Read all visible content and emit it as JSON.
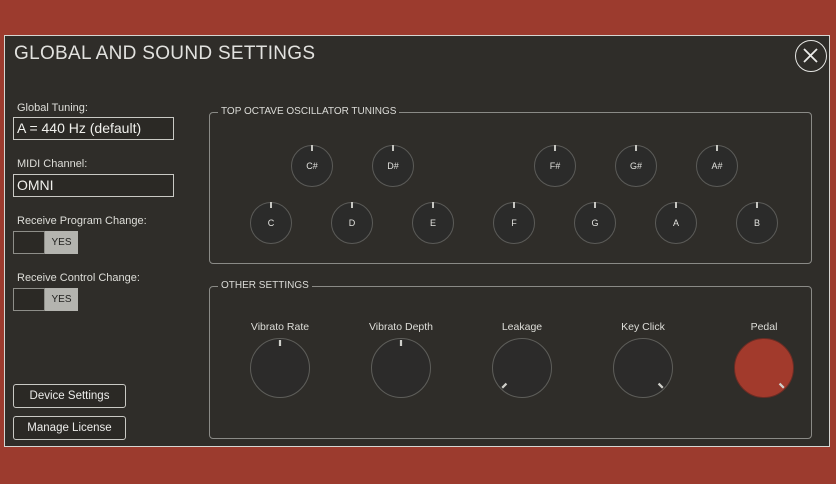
{
  "dialog": {
    "title": "GLOBAL AND SOUND SETTINGS",
    "close_icon": "close-icon"
  },
  "left": {
    "global_tuning_label": "Global Tuning:",
    "global_tuning_value": "A = 440 Hz (default)",
    "midi_channel_label": "MIDI Channel:",
    "midi_channel_value": "OMNI",
    "receive_program_change_label": "Receive Program Change:",
    "receive_program_change_value": "YES",
    "receive_control_change_label": "Receive Control Change:",
    "receive_control_change_value": "YES",
    "device_settings_button": "Device Settings",
    "manage_license_button": "Manage License"
  },
  "oscillators": {
    "title": "TOP OCTAVE OSCILLATOR TUNINGS",
    "sharps": [
      "C#",
      "D#",
      "F#",
      "G#",
      "A#"
    ],
    "naturals": [
      "C",
      "D",
      "E",
      "F",
      "G",
      "A",
      "B"
    ]
  },
  "other_settings": {
    "title": "OTHER SETTINGS",
    "knobs": [
      {
        "label": "Vibrato Rate",
        "value_fraction": 0.5
      },
      {
        "label": "Vibrato Depth",
        "value_fraction": 0.5
      },
      {
        "label": "Leakage",
        "value_fraction": 0.0
      },
      {
        "label": "Key Click",
        "value_fraction": 1.0
      },
      {
        "label": "Pedal",
        "value_fraction": 1.0
      }
    ]
  },
  "colors": {
    "background": "#9c3b2e",
    "panel": "#2f2d29",
    "pedal_knob": "#a23a2c"
  }
}
